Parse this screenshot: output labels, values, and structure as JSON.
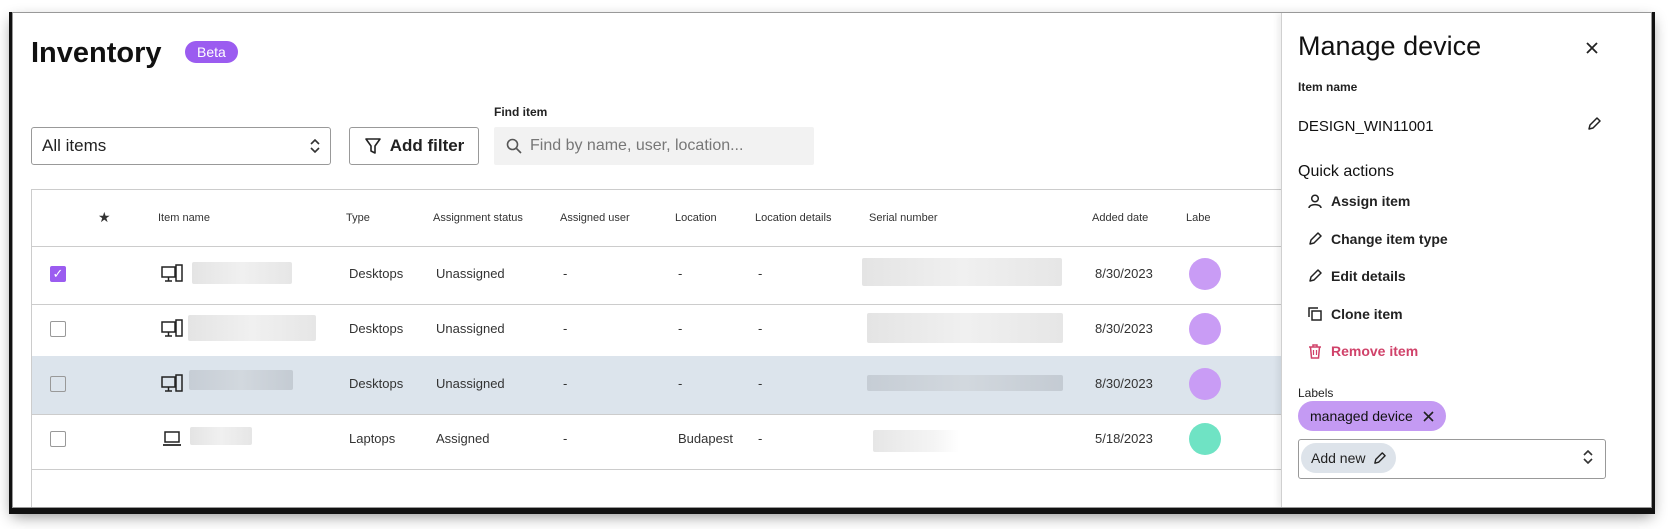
{
  "header": {
    "title": "Inventory",
    "badge": "Beta"
  },
  "toolbar": {
    "view_select": "All items",
    "add_filter": "Add filter",
    "find_label": "Find item",
    "search_placeholder": "Find by name, user, location..."
  },
  "table": {
    "columns": {
      "star": "★",
      "item_name": "Item name",
      "type": "Type",
      "assignment_status": "Assignment status",
      "assigned_user": "Assigned user",
      "location": "Location",
      "location_details": "Location details",
      "serial_number": "Serial number",
      "added_date": "Added date",
      "labels": "Labe"
    },
    "rows": [
      {
        "checked": true,
        "type": "Desktops",
        "status": "Unassigned",
        "user": "-",
        "location": "-",
        "details": "-",
        "date": "8/30/2023",
        "icon": "desktop-icon"
      },
      {
        "checked": false,
        "type": "Desktops",
        "status": "Unassigned",
        "user": "-",
        "location": "-",
        "details": "-",
        "date": "8/30/2023",
        "icon": "desktop-icon"
      },
      {
        "checked": false,
        "type": "Desktops",
        "status": "Unassigned",
        "user": "-",
        "location": "-",
        "details": "-",
        "date": "8/30/2023",
        "icon": "desktop-icon"
      },
      {
        "checked": false,
        "type": "Laptops",
        "status": "Assigned",
        "user": "-",
        "location": "Budapest",
        "details": "-",
        "date": "5/18/2023",
        "icon": "laptop-icon"
      }
    ]
  },
  "panel": {
    "title": "Manage device",
    "item_name_label": "Item name",
    "item_name": "DESIGN_WIN11001",
    "quick_actions_title": "Quick actions",
    "actions": {
      "assign": "Assign item",
      "change_type": "Change item type",
      "edit": "Edit details",
      "clone": "Clone item",
      "remove": "Remove item"
    },
    "labels_title": "Labels",
    "label_chip": "managed device",
    "add_new": "Add new"
  },
  "colors": {
    "accent": "#9b5cf0",
    "danger": "#d0426a",
    "selected_row": "#dce4ec"
  }
}
